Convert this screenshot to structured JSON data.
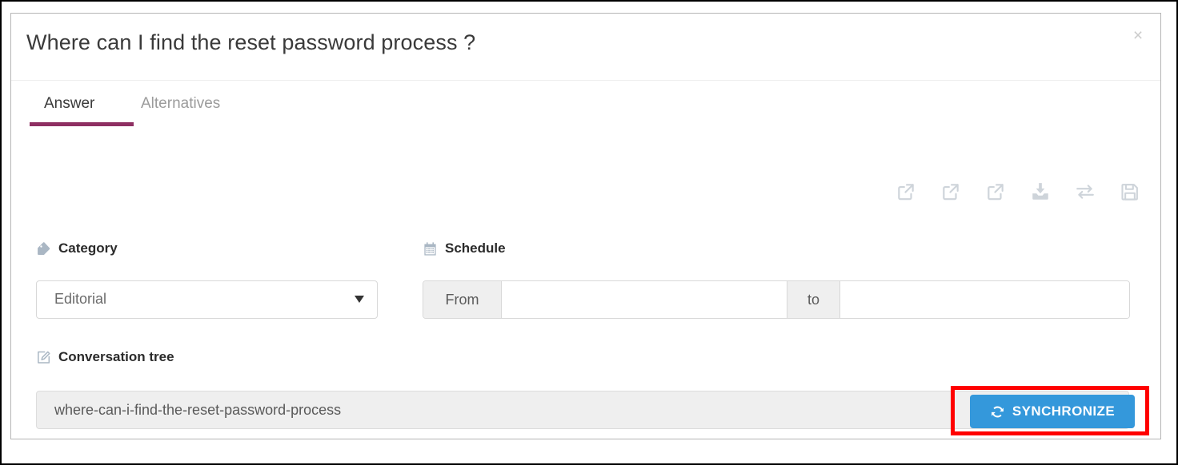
{
  "dialog": {
    "title": "Where can I find the reset password process ?",
    "close_label": "×"
  },
  "tabs": [
    {
      "label": "Answer",
      "active": true
    },
    {
      "label": "Alternatives",
      "active": false
    }
  ],
  "toolbar": {
    "icons": [
      {
        "name": "external-link-icon-1",
        "title": "Open"
      },
      {
        "name": "external-link-icon-2",
        "title": "Open"
      },
      {
        "name": "external-link-icon-3",
        "title": "Open"
      },
      {
        "name": "download-icon",
        "title": "Download"
      },
      {
        "name": "exchange-icon",
        "title": "Exchange"
      },
      {
        "name": "save-icon",
        "title": "Save"
      }
    ]
  },
  "fields": {
    "category": {
      "label": "Category",
      "icon": "tag-icon",
      "value": "Editorial",
      "options": [
        "Editorial"
      ]
    },
    "schedule": {
      "label": "Schedule",
      "icon": "calendar-icon",
      "from_addon": "From",
      "from_value": "",
      "from_placeholder": "",
      "to_addon": "to",
      "to_value": "",
      "to_placeholder": ""
    },
    "conversation_tree": {
      "label": "Conversation tree",
      "icon": "edit-icon",
      "value": "where-can-i-find-the-reset-password-process",
      "placeholder": ""
    }
  },
  "sync_button": {
    "label": "SYNCHRONIZE",
    "icon": "sync-icon"
  },
  "colors": {
    "accent": "#8e2f62",
    "primary_button": "#3498db",
    "highlight_box": "#ff0000",
    "icon_gray": "#ced4da",
    "label_icon": "#aab7c4"
  }
}
